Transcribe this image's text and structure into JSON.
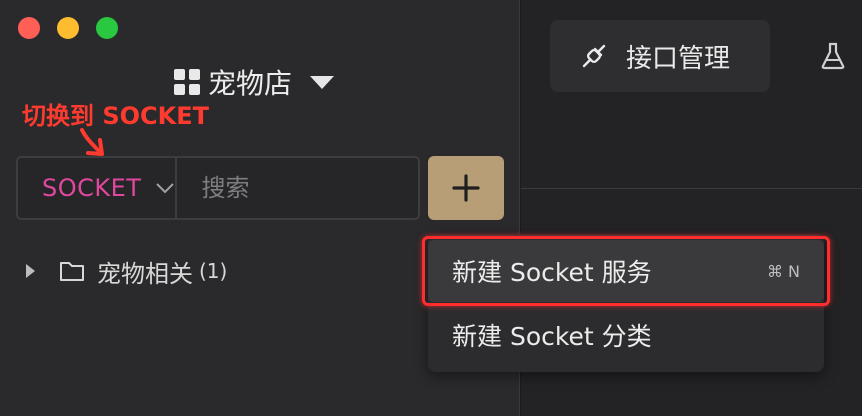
{
  "project": {
    "name": "宠物店",
    "icon": "grid-icon"
  },
  "annotation": {
    "text": "切换到 SOCKET",
    "color": "#ff3b30"
  },
  "search": {
    "type_label": "SOCKET",
    "type_color": "#e0479e",
    "placeholder": "搜索"
  },
  "add_button": {
    "label": "+",
    "color": "#b89e76"
  },
  "tree": [
    {
      "label": "宠物相关",
      "count": "(1)",
      "icon": "folder-icon"
    }
  ],
  "main": {
    "tab_label": "接口管理",
    "tab_icon": "plug-icon",
    "extra_icon": "flask-icon"
  },
  "menu": {
    "items": [
      {
        "label": "新建 Socket 服务",
        "shortcut": "⌘ N"
      },
      {
        "label": "新建 Socket 分类",
        "shortcut": ""
      }
    ]
  },
  "colors": {
    "sidebar_bg": "#2a2a2c",
    "highlight": "#ff2d2d"
  }
}
